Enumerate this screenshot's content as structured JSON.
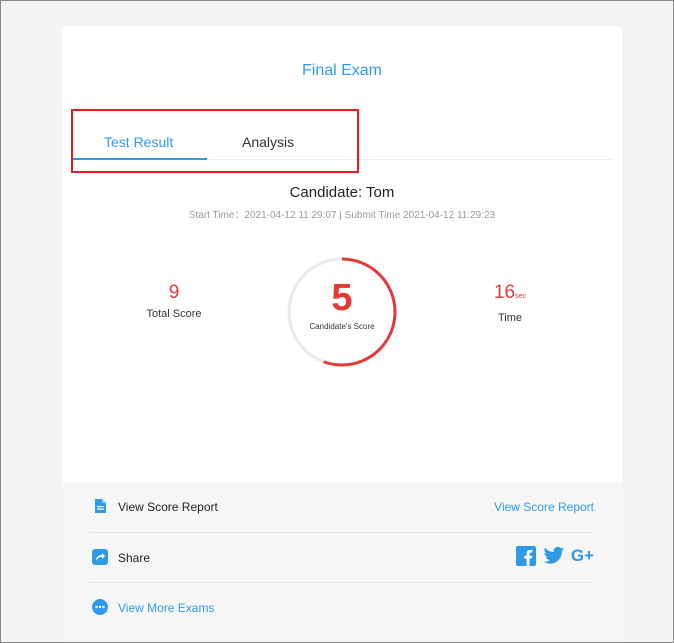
{
  "exam": {
    "title": "Final Exam"
  },
  "tabs": [
    {
      "label": "Test Result",
      "active": true
    },
    {
      "label": "Analysis",
      "active": false
    }
  ],
  "candidate": {
    "prefix": "Candidate: ",
    "name": "Tom",
    "times": "Start Time：2021-04-12 11:29:07 | Submit Time 2021-04-12 11:29:23"
  },
  "stats": {
    "total_score": {
      "value": "9",
      "label": "Total Score"
    },
    "candidate_score": {
      "value": "5",
      "label": "Candidate's Score",
      "fraction": 0.5556
    },
    "time": {
      "value": "16",
      "unit": "sec",
      "label": "Time"
    }
  },
  "footer": {
    "score_report": {
      "label": "View Score Report",
      "link": "View Score Report",
      "icon": "document-icon"
    },
    "share": {
      "label": "Share",
      "icon": "share-icon",
      "social": [
        "facebook-icon",
        "twitter-icon",
        "google-plus-icon"
      ],
      "gplus_text": "G+"
    },
    "more_exams": {
      "label": "View More Exams",
      "icon": "more-icon"
    }
  },
  "colors": {
    "accent": "#2f9be8",
    "score": "#e53935",
    "highlight": "#e02020"
  }
}
